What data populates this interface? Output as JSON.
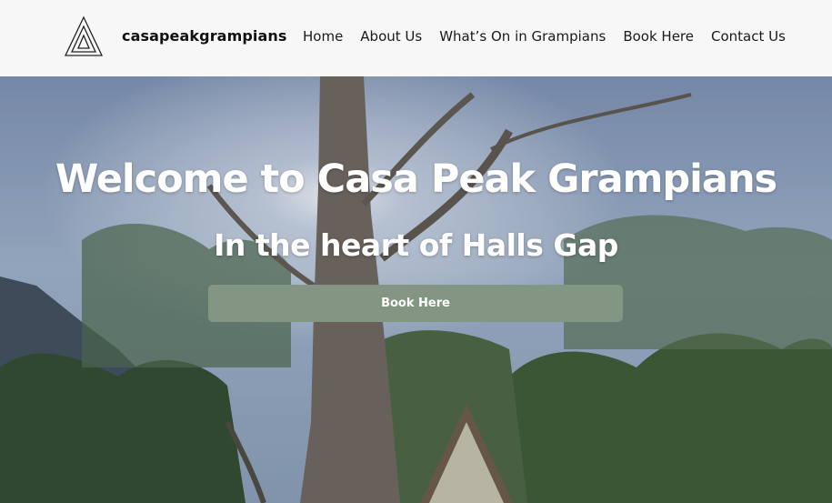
{
  "header": {
    "site_name": "casapeakgrampians",
    "logo_icon": "triangle-spiral-logo-icon"
  },
  "nav": {
    "items": [
      {
        "label": "Home"
      },
      {
        "label": "About Us"
      },
      {
        "label": "What’s On in Grampians"
      },
      {
        "label": "Book Here"
      },
      {
        "label": "Contact Us"
      }
    ]
  },
  "hero": {
    "title": "Welcome to Casa Peak Grampians",
    "subtitle": "In the heart of Halls Gap",
    "button_label": "Book Here",
    "button_color": "#839683"
  }
}
